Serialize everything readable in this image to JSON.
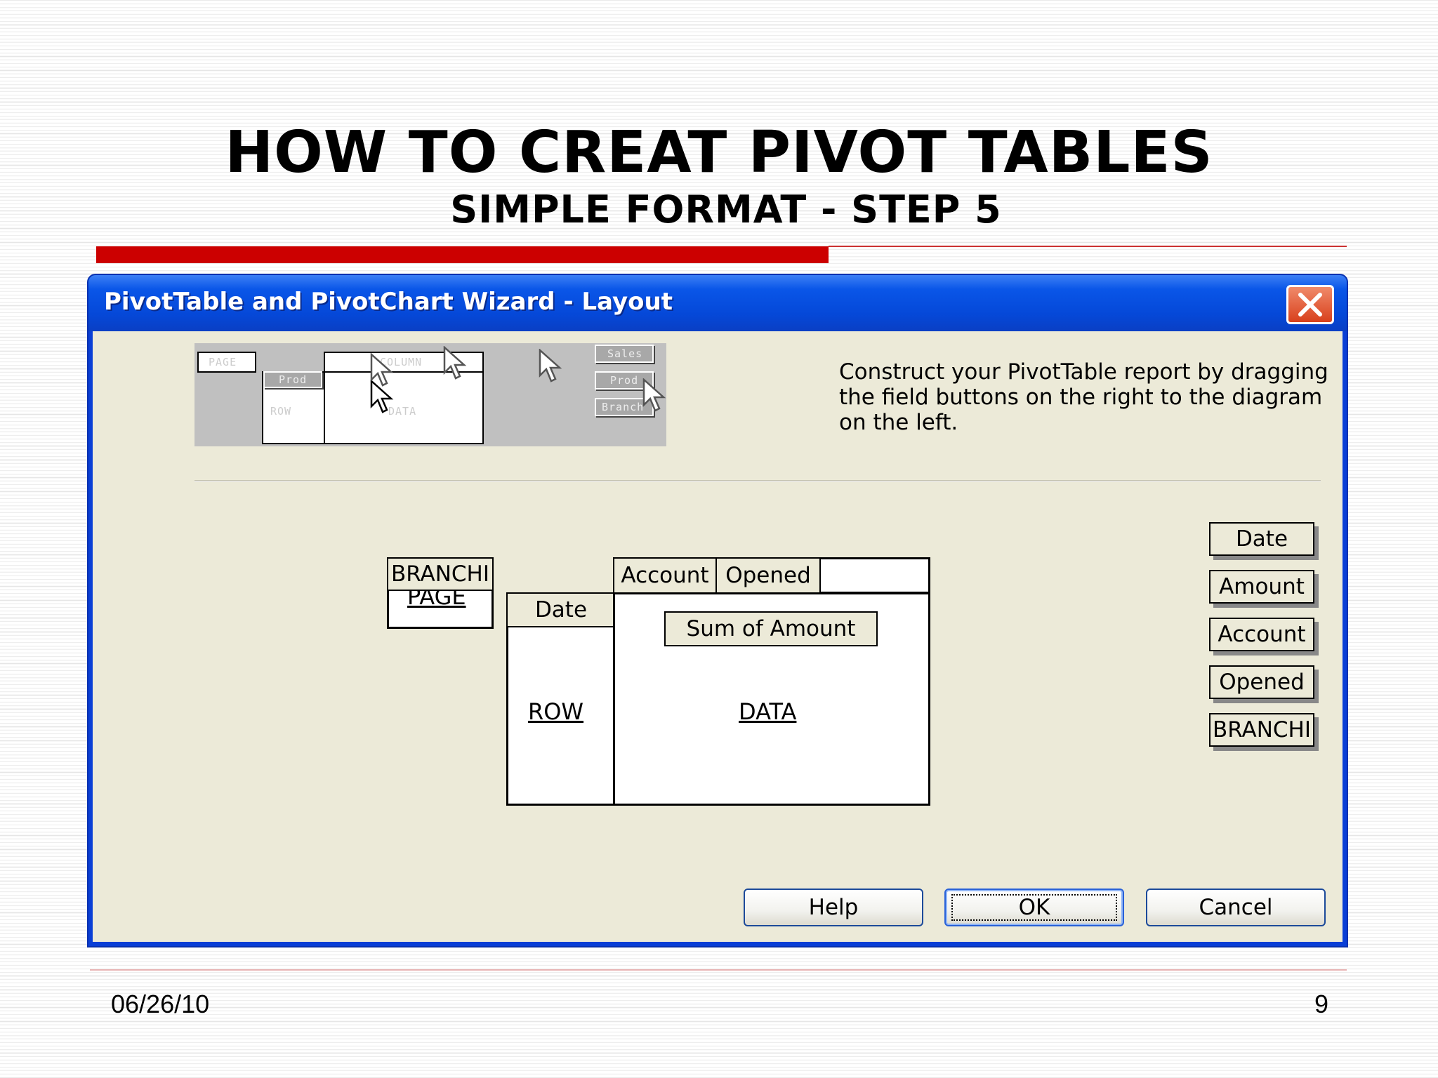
{
  "slide": {
    "title": "HOW TO CREAT PIVOT TABLES",
    "subtitle": "SIMPLE FORMAT - STEP 5",
    "date": "06/26/10",
    "page_number": "9"
  },
  "dialog": {
    "title": "PivotTable and PivotChart Wizard - Layout",
    "instructions": "Construct your PivotTable report by dragging the field buttons on the right to the diagram on the left.",
    "preview": {
      "page_label": "PAGE",
      "column_label": "COLUMN",
      "row_label": "ROW",
      "data_label": "DATA",
      "chip_prod": "Prod",
      "field_chips": [
        "Sales",
        "Prod",
        "Branch"
      ]
    },
    "layout": {
      "page_field": "BRANCHI",
      "page_label": "PAGE",
      "column_fields": [
        "Account",
        "Opened"
      ],
      "row_field": "Date",
      "row_label": "ROW",
      "data_field": "Sum of Amount",
      "data_label": "DATA"
    },
    "field_list": [
      "Date",
      "Amount",
      "Account",
      "Opened",
      "BRANCHI"
    ],
    "buttons": {
      "help": "Help",
      "ok": "OK",
      "cancel": "Cancel"
    },
    "colors": {
      "titlebar": "#0548d8",
      "client": "#ecead8",
      "accent": "#cc0000"
    }
  }
}
